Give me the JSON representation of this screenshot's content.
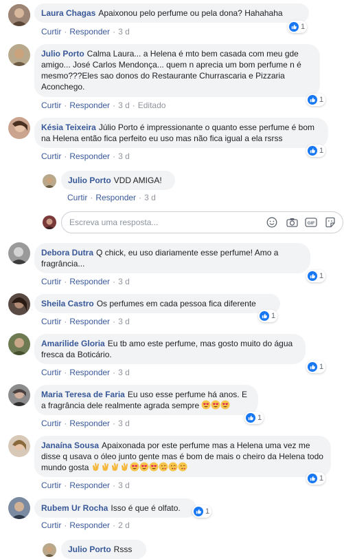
{
  "comments": [
    {
      "author": "Laura Chagas",
      "text": "Apaixonou pelo perfume ou pela dona? Hahahaha",
      "likes": "1",
      "time": "3 d",
      "edited": ""
    },
    {
      "author": "Julio Porto",
      "text": "Calma Laura... a Helena é mto bem casada com meu gde amigo... José Carlos Mendonça... quem n aprecia um bom perfume n é mesmo???Eles sao donos do Restaurante Churrascaria e Pizzaria Aconchego.",
      "likes": "1",
      "time": "3 d",
      "edited": "Editado"
    },
    {
      "author": "Késia Teixeira",
      "text": "Júlio Porto é impressionante o quanto esse perfume é bom na Helena então fica perfeito eu uso mas não fica igual a ela rsrss",
      "likes": "1",
      "time": "3 d"
    },
    {
      "author": "Debora Dutra",
      "text": "Q chick, eu uso diariamente esse perfume! Amo a fragrância...",
      "likes": "1",
      "time": "3 d"
    },
    {
      "author": "Sheila Castro",
      "text": "Os perfumes em cada pessoa fica diferente",
      "likes": "1",
      "time": "3 d"
    },
    {
      "author": "Amarilide Gloria",
      "text": "Eu tb amo este perfume, mas gosto muito do água fresca da Boticário.",
      "likes": "1",
      "time": "3 d"
    },
    {
      "author": "Maria Teresa de Faria",
      "text": "Eu uso esse perfume há anos. E a fragrância dele realmente agrada sempre",
      "likes": "1",
      "time": "3 d"
    },
    {
      "author": "Janaína Sousa",
      "text": "Apaixonada por este perfume mas a Helena uma vez me disse q usava o óleo junto gente mas é bom de mais o cheiro da Helena todo mundo gosta",
      "likes": "1",
      "time": "3 d"
    },
    {
      "author": "Rubem Ur Rocha",
      "text": "Isso é que é olfato.",
      "likes": "1",
      "time": "2 d"
    }
  ],
  "replies": [
    {
      "author": "Julio Porto",
      "text": "VDD AMIGA!",
      "time": "3 d"
    },
    {
      "author": "Julio Porto",
      "text": "Rsss"
    }
  ],
  "actions": {
    "like": "Curtir",
    "reply": "Responder",
    "sep": "·"
  },
  "reply_box": {
    "placeholder": "Escreva uma resposta..."
  },
  "icons": [
    "emoji-icon",
    "camera-icon",
    "gif-icon",
    "sticker-icon",
    "like-thumb-icon"
  ],
  "colors": {
    "author": "#385898",
    "bubble": "#f2f3f5",
    "like": "#1877f2"
  }
}
